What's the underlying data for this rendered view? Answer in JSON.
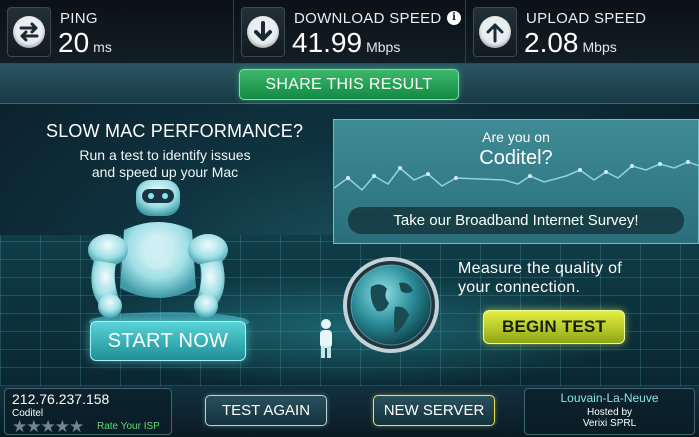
{
  "results": {
    "ping": {
      "label": "PING",
      "value": "20",
      "unit": "ms",
      "icon": "ping-arrows-icon"
    },
    "download": {
      "label": "DOWNLOAD SPEED",
      "value": "41.99",
      "unit": "Mbps",
      "icon": "download-arrow-icon",
      "info": "i"
    },
    "upload": {
      "label": "UPLOAD SPEED",
      "value": "2.08",
      "unit": "Mbps",
      "icon": "upload-arrow-icon"
    }
  },
  "share": {
    "label": "SHARE THIS RESULT"
  },
  "mac_ad": {
    "title": "SLOW MAC PERFORMANCE?",
    "line1": "Run a test to identify issues",
    "line2": "and speed up your Mac",
    "button": "START NOW"
  },
  "survey": {
    "question": "Are you on",
    "isp": "Coditel?",
    "cta": "Take our Broadband Internet Survey!"
  },
  "measure": {
    "line1": "Measure the quality of",
    "line2": "your connection.",
    "button": "BEGIN TEST"
  },
  "footer": {
    "ip": "212.76.237.158",
    "isp": "Coditel",
    "stars": "★★★★★",
    "rate_label": "Rate Your ISP",
    "test_again": "TEST AGAIN",
    "new_server": "NEW SERVER",
    "server_city": "Louvain-La-Neuve",
    "hosted_label": "Hosted by",
    "sponsor": "Verixi SPRL"
  },
  "colors": {
    "share_green": "#2ea85d",
    "start_cyan": "#3cb8c0",
    "begin_yellow": "#c8d92a",
    "rate_green": "#66d37c"
  }
}
